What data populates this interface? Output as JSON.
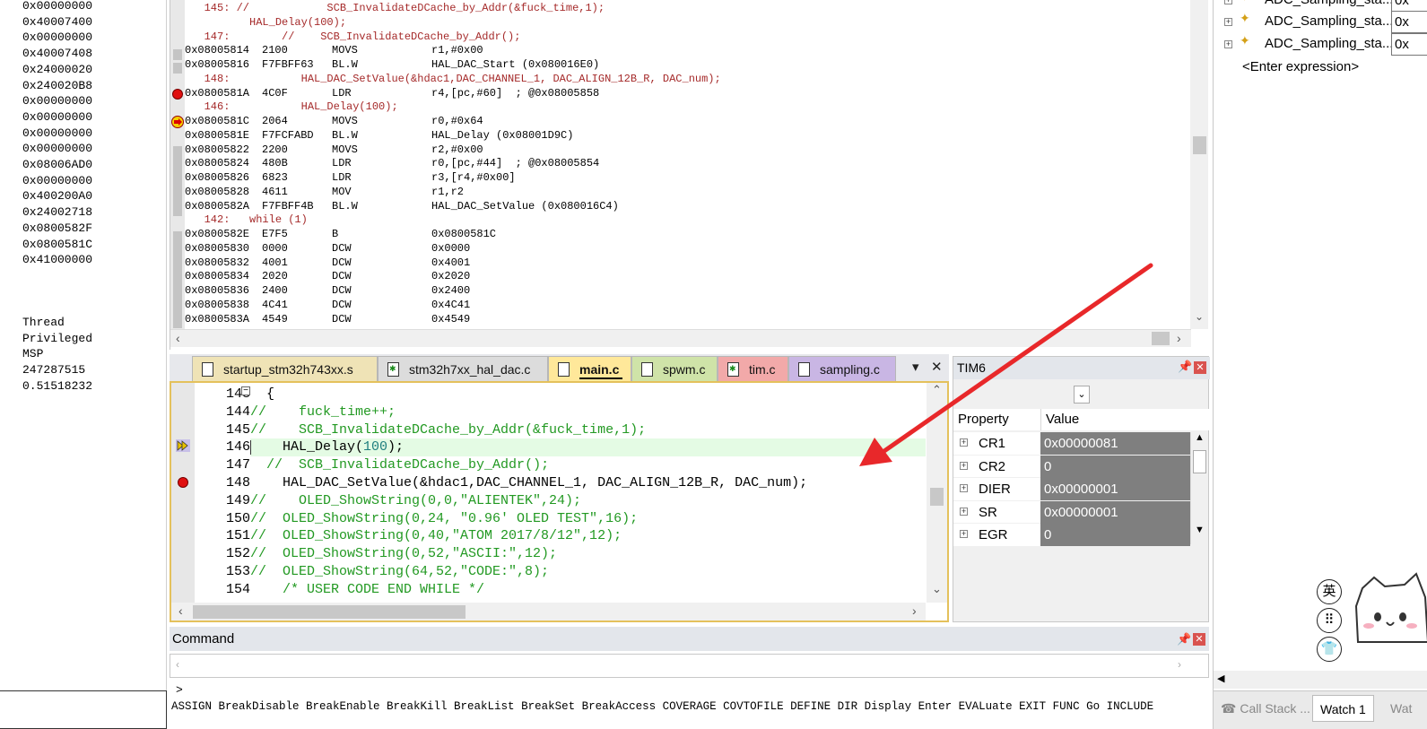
{
  "registers": {
    "values": [
      "0x00000000",
      "0x40007400",
      "0x00000000",
      "0x40007408",
      "0x24000020",
      "0x240020B8",
      "0x00000000",
      "0x00000000",
      "0x00000000",
      "0x00000000",
      "0x08006AD0",
      "0x00000000",
      "0x400200A0",
      "0x24002718",
      "0x0800582F",
      "0x0800581C",
      "0x41000000"
    ],
    "extra": [
      "Thread",
      "Privileged",
      "MSP",
      "247287515",
      "0.51518232"
    ]
  },
  "disassembly": {
    "lines": [
      {
        "type": "src",
        "text": "   145: //            SCB_InvalidateDCache_by_Addr(&fuck_time,1);"
      },
      {
        "type": "src",
        "text": "          HAL_Delay(100);"
      },
      {
        "type": "src",
        "text": "   147:        //    SCB_InvalidateDCache_by_Addr();"
      },
      {
        "type": "asm",
        "addr": "0x08005814",
        "op": "2100",
        "mn": "MOVS",
        "args": "r1,#0x00"
      },
      {
        "type": "asm",
        "addr": "0x08005816",
        "op": "F7FBFF63",
        "mn": "BL.W",
        "args": "HAL_DAC_Start (0x080016E0)"
      },
      {
        "type": "src",
        "text": "   148:           HAL_DAC_SetValue(&hdac1,DAC_CHANNEL_1, DAC_ALIGN_12B_R, DAC_num);"
      },
      {
        "type": "asm",
        "addr": "0x0800581A",
        "op": "4C0F",
        "mn": "LDR",
        "args": "r4,[pc,#60]  ; @0x08005858"
      },
      {
        "type": "src",
        "text": "   146:           HAL_Delay(100);"
      },
      {
        "type": "asm",
        "addr": "0x0800581C",
        "op": "2064",
        "mn": "MOVS",
        "args": "r0,#0x64"
      },
      {
        "type": "asm",
        "addr": "0x0800581E",
        "op": "F7FCFABD",
        "mn": "BL.W",
        "args": "HAL_Delay (0x08001D9C)"
      },
      {
        "type": "asm",
        "addr": "0x08005822",
        "op": "2200",
        "mn": "MOVS",
        "args": "r2,#0x00"
      },
      {
        "type": "asm",
        "addr": "0x08005824",
        "op": "480B",
        "mn": "LDR",
        "args": "r0,[pc,#44]  ; @0x08005854"
      },
      {
        "type": "asm",
        "addr": "0x08005826",
        "op": "6823",
        "mn": "LDR",
        "args": "r3,[r4,#0x00]"
      },
      {
        "type": "asm",
        "addr": "0x08005828",
        "op": "4611",
        "mn": "MOV",
        "args": "r1,r2"
      },
      {
        "type": "asm",
        "addr": "0x0800582A",
        "op": "F7FBFF4B",
        "mn": "BL.W",
        "args": "HAL_DAC_SetValue (0x080016C4)"
      },
      {
        "type": "src",
        "text": "   142:   while (1)"
      },
      {
        "type": "asm",
        "addr": "0x0800582E",
        "op": "E7F5",
        "mn": "B",
        "args": "0x0800581C"
      },
      {
        "type": "asm",
        "addr": "0x08005830",
        "op": "0000",
        "mn": "DCW",
        "args": "0x0000"
      },
      {
        "type": "asm",
        "addr": "0x08005832",
        "op": "4001",
        "mn": "DCW",
        "args": "0x4001"
      },
      {
        "type": "asm",
        "addr": "0x08005834",
        "op": "2020",
        "mn": "DCW",
        "args": "0x2020"
      },
      {
        "type": "asm",
        "addr": "0x08005836",
        "op": "2400",
        "mn": "DCW",
        "args": "0x2400"
      },
      {
        "type": "asm",
        "addr": "0x08005838",
        "op": "4C41",
        "mn": "DCW",
        "args": "0x4C41"
      },
      {
        "type": "asm",
        "addr": "0x0800583A",
        "op": "4549",
        "mn": "DCW",
        "args": "0x4549"
      }
    ]
  },
  "editor": {
    "tabs": [
      {
        "label": "startup_stm32h743xx.s",
        "color": "#efe3b6"
      },
      {
        "label": "stm32h7xx_hal_dac.c",
        "color": "#dcdcdc"
      },
      {
        "label": "main.c",
        "color": "#ffe89a"
      },
      {
        "label": "spwm.c",
        "color": "#cfe3a8"
      },
      {
        "label": "tim.c",
        "color": "#f2a9a9"
      },
      {
        "label": "sampling.c",
        "color": "#c9b6e4"
      }
    ],
    "line_numbers": [
      "143",
      "144",
      "145",
      "146",
      "147",
      "148",
      "149",
      "150",
      "151",
      "152",
      "153",
      "154"
    ],
    "lines": [
      {
        "pre": "  {",
        "comment": ""
      },
      {
        "pre": "",
        "comment": "//    fuck_time++;"
      },
      {
        "pre": "",
        "comment": "//    SCB_InvalidateDCache_by_Addr(&fuck_time,1);"
      },
      {
        "pre": "    HAL_Delay(",
        "num": "100",
        "post": ");"
      },
      {
        "pre": "  ",
        "comment": "//  SCB_InvalidateDCache_by_Addr();"
      },
      {
        "pre": "    HAL_DAC_SetValue(&hdac1,DAC_CHANNEL_1, DAC_ALIGN_12B_R, DAC_num);",
        "comment": ""
      },
      {
        "pre": "",
        "comment": "//    OLED_ShowString(0,0,\"ALIENTEK\",24);"
      },
      {
        "pre": "",
        "comment": "//  OLED_ShowString(0,24, \"0.96' OLED TEST\",16);"
      },
      {
        "pre": "",
        "comment": "//  OLED_ShowString(0,40,\"ATOM 2017/8/12\",12);"
      },
      {
        "pre": "",
        "comment": "//  OLED_ShowString(0,52,\"ASCII:\",12);"
      },
      {
        "pre": "",
        "comment": "//  OLED_ShowString(64,52,\"CODE:\",8);"
      },
      {
        "pre": "    ",
        "comment": "/* USER CODE END WHILE */"
      }
    ]
  },
  "tim6": {
    "title": "TIM6",
    "header_property": "Property",
    "header_value": "Value",
    "rows": [
      {
        "name": "CR1",
        "value": "0x00000081"
      },
      {
        "name": "CR2",
        "value": "0"
      },
      {
        "name": "DIER",
        "value": "0x00000001"
      },
      {
        "name": "SR",
        "value": "0x00000001"
      },
      {
        "name": "EGR",
        "value": "0"
      }
    ]
  },
  "command": {
    "title": "Command",
    "prompt": ">",
    "commands": "ASSIGN BreakDisable BreakEnable BreakKill BreakList BreakSet BreakAccess COVERAGE COVTOFILE DEFINE DIR Display Enter EVALuate EXIT FUNC Go INCLUDE"
  },
  "watch": {
    "rows": [
      {
        "name": "ADC_Sampling_sta...",
        "value": "0x"
      },
      {
        "name": "ADC_Sampling_sta...",
        "value": "0x"
      }
    ],
    "enter_expression": "<Enter expression>",
    "tabs": [
      "Call Stack ...",
      "Watch 1",
      "Wat"
    ]
  },
  "mascot": {
    "btn1": "英",
    "btn2": "⠿",
    "btn3": "👕"
  },
  "colors": {
    "annotation_arrow": "#e8282a",
    "current_line": "#e4fbe4",
    "comment": "#229922",
    "disasm_source": "#a52a2a"
  }
}
